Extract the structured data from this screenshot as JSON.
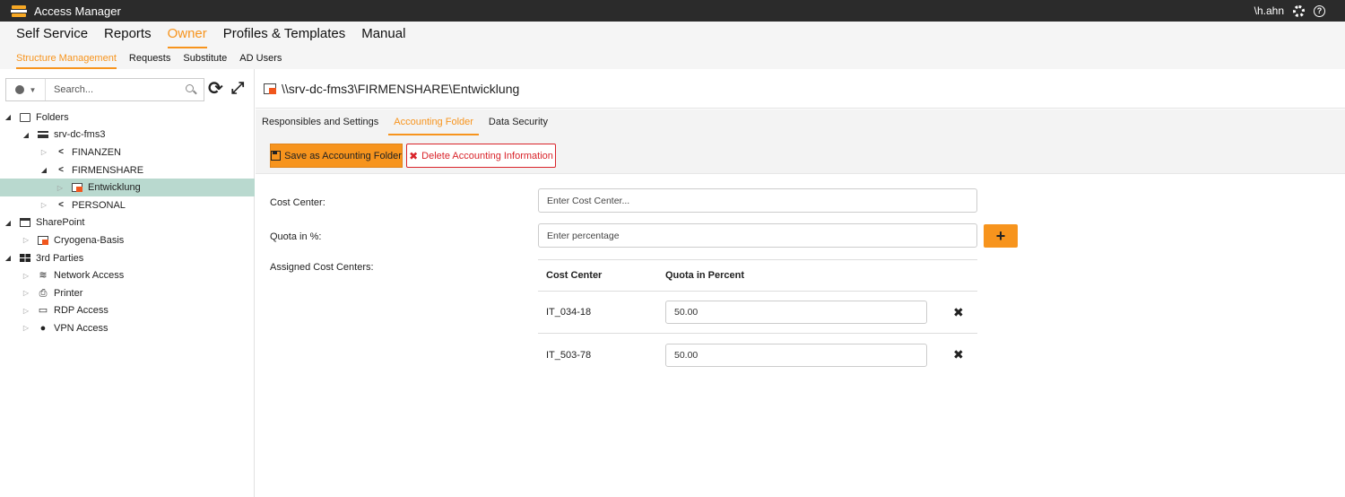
{
  "app": {
    "title": "Access Manager",
    "user": "\\h.ahn",
    "help_glyph": "?"
  },
  "main_nav": [
    {
      "label": "Self Service",
      "active": false
    },
    {
      "label": "Reports",
      "active": false
    },
    {
      "label": "Owner",
      "active": true
    },
    {
      "label": "Profiles & Templates",
      "active": false
    },
    {
      "label": "Manual",
      "active": false
    }
  ],
  "sub_nav": [
    {
      "label": "Structure Management",
      "active": true
    },
    {
      "label": "Requests",
      "active": false
    },
    {
      "label": "Substitute",
      "active": false
    },
    {
      "label": "AD Users",
      "active": false
    }
  ],
  "search": {
    "placeholder": "Search..."
  },
  "tree": {
    "folders": "Folders",
    "server": "srv-dc-fms3",
    "finanzen": "FINANZEN",
    "firmenshare": "FIRMENSHARE",
    "entwicklung": "Entwicklung",
    "personal": "PERSONAL",
    "sharepoint": "SharePoint",
    "cryogena": "Cryogena-Basis",
    "third_parties": "3rd Parties",
    "network": "Network Access",
    "printer": "Printer",
    "rdp": "RDP Access",
    "vpn": "VPN Access"
  },
  "detail": {
    "path": "\\\\srv-dc-fms3\\FIRMENSHARE\\Entwicklung",
    "tabs": [
      {
        "label": "Responsibles and Settings",
        "active": false
      },
      {
        "label": "Accounting Folder",
        "active": true
      },
      {
        "label": "Data Security",
        "active": false
      }
    ],
    "save_label": "Save as Accounting Folder",
    "delete_label": "Delete Accounting Information",
    "cost_center_label": "Cost Center:",
    "cost_center_placeholder": "Enter Cost Center...",
    "quota_label": "Quota in %:",
    "quota_placeholder": "Enter percentage",
    "assigned_label": "Assigned Cost Centers:",
    "table": {
      "headers": [
        "Cost Center",
        "Quota in Percent"
      ],
      "rows": [
        {
          "cost_center": "IT_034-18",
          "quota": "50.00"
        },
        {
          "cost_center": "IT_503-78",
          "quota": "50.00"
        }
      ]
    }
  },
  "colors": {
    "accent": "#f7941d",
    "danger": "#d9232a",
    "selected_row": "#b9d9cf",
    "titlebar": "#2b2b2b"
  }
}
